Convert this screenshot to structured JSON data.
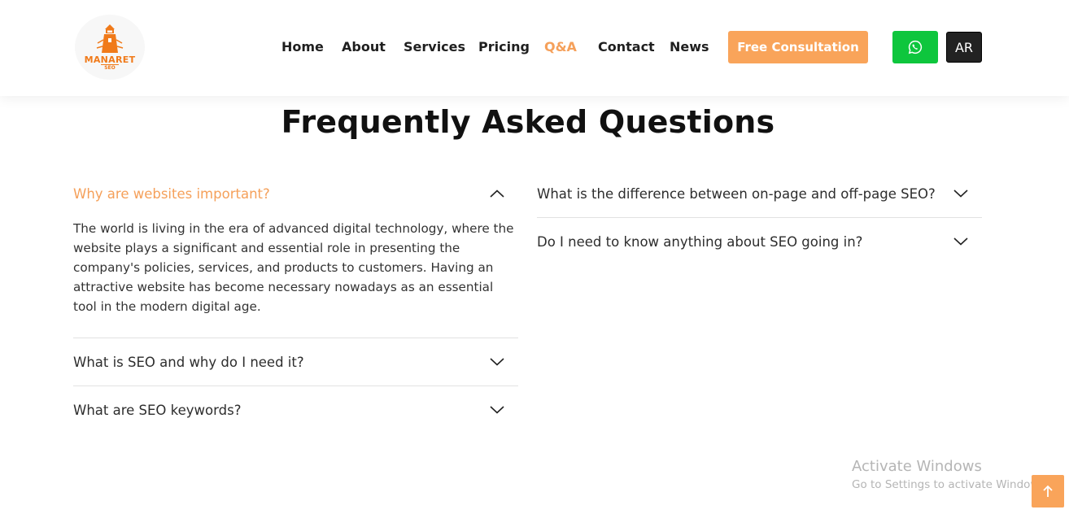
{
  "brand": {
    "logo_text": "MANARET",
    "logo_sub": "SEO",
    "accent_color": "#f9a45a",
    "logo_color": "#f07a1a"
  },
  "nav": {
    "items": [
      {
        "label": "Home",
        "active": false
      },
      {
        "label": "About",
        "active": false
      },
      {
        "label": "Services",
        "active": false
      },
      {
        "label": "Pricing",
        "active": false
      },
      {
        "label": "Q&A",
        "active": true
      },
      {
        "label": "Contact",
        "active": false
      },
      {
        "label": "News",
        "active": false
      }
    ],
    "consult_label": "Free Consultation",
    "whatsapp_icon": "whatsapp-icon",
    "lang_label": "AR"
  },
  "page": {
    "title": "Frequently Asked Questions"
  },
  "faq": {
    "left": [
      {
        "question": "Why are websites important?",
        "open": true,
        "answer": "The world is living in the era of advanced digital technology, where the website plays a significant and essential role in presenting the company's policies, services, and products to customers. Having an attractive website has become necessary nowadays as an essential tool in the modern digital age."
      },
      {
        "question": "What is SEO and why do I need it?",
        "open": false
      },
      {
        "question": "What are SEO keywords?",
        "open": false
      }
    ],
    "right": [
      {
        "question": "What is the difference between on-page and off-page SEO?",
        "open": false
      },
      {
        "question": "Do I need to know anything about SEO going in?",
        "open": false
      }
    ]
  },
  "watermark": {
    "title": "Activate Windows",
    "subtitle": "Go to Settings to activate Windows."
  },
  "scroll_top_icon": "arrow-up-icon"
}
